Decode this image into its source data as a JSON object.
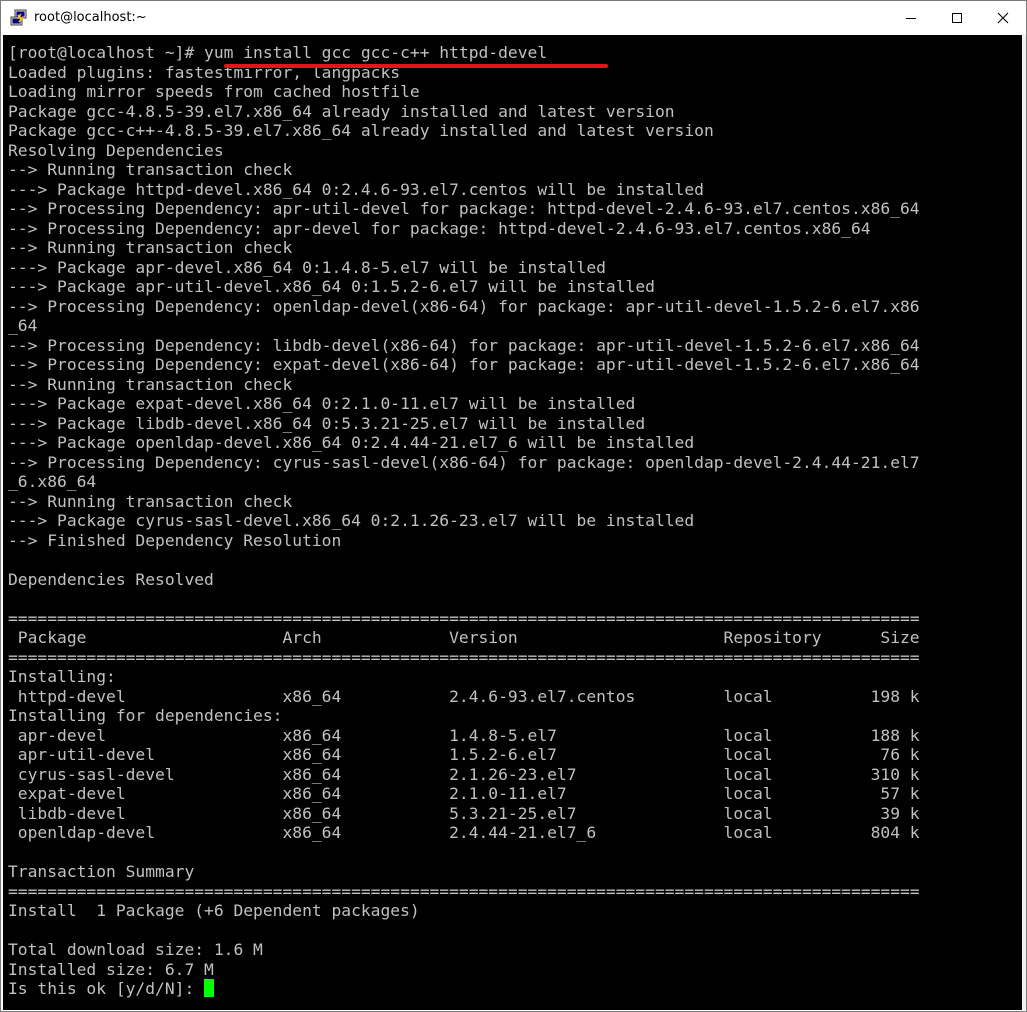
{
  "window": {
    "title": "root@localhost:~",
    "icon": "putty-icon",
    "controls": {
      "minimize": "minimize-icon",
      "maximize": "maximize-icon",
      "close": "close-icon"
    }
  },
  "terminal": {
    "prompt": "[root@localhost ~]# ",
    "command": "yum install gcc gcc-c++ httpd-devel",
    "output": [
      "Loaded plugins: fastestmirror, langpacks",
      "Loading mirror speeds from cached hostfile",
      "Package gcc-4.8.5-39.el7.x86_64 already installed and latest version",
      "Package gcc-c++-4.8.5-39.el7.x86_64 already installed and latest version",
      "Resolving Dependencies",
      "--> Running transaction check",
      "---> Package httpd-devel.x86_64 0:2.4.6-93.el7.centos will be installed",
      "--> Processing Dependency: apr-util-devel for package: httpd-devel-2.4.6-93.el7.centos.x86_64",
      "--> Processing Dependency: apr-devel for package: httpd-devel-2.4.6-93.el7.centos.x86_64",
      "--> Running transaction check",
      "---> Package apr-devel.x86_64 0:1.4.8-5.el7 will be installed",
      "---> Package apr-util-devel.x86_64 0:1.5.2-6.el7 will be installed",
      "--> Processing Dependency: openldap-devel(x86-64) for package: apr-util-devel-1.5.2-6.el7.x86",
      "_64",
      "--> Processing Dependency: libdb-devel(x86-64) for package: apr-util-devel-1.5.2-6.el7.x86_64",
      "--> Processing Dependency: expat-devel(x86-64) for package: apr-util-devel-1.5.2-6.el7.x86_64",
      "--> Running transaction check",
      "---> Package expat-devel.x86_64 0:2.1.0-11.el7 will be installed",
      "---> Package libdb-devel.x86_64 0:5.3.21-25.el7 will be installed",
      "---> Package openldap-devel.x86_64 0:2.4.44-21.el7_6 will be installed",
      "--> Processing Dependency: cyrus-sasl-devel(x86-64) for package: openldap-devel-2.4.44-21.el7",
      "_6.x86_64",
      "--> Running transaction check",
      "---> Package cyrus-sasl-devel.x86_64 0:2.1.26-23.el7 will be installed",
      "--> Finished Dependency Resolution",
      "",
      "Dependencies Resolved",
      "",
      "=============================================================================================",
      " Package                    Arch             Version                     Repository      Size",
      "=============================================================================================",
      "Installing:",
      " httpd-devel                x86_64           2.4.6-93.el7.centos         local          198 k",
      "Installing for dependencies:",
      " apr-devel                  x86_64           1.4.8-5.el7                 local          188 k",
      " apr-util-devel             x86_64           1.5.2-6.el7                 local           76 k",
      " cyrus-sasl-devel           x86_64           2.1.26-23.el7               local          310 k",
      " expat-devel                x86_64           2.1.0-11.el7                local           57 k",
      " libdb-devel                x86_64           5.3.21-25.el7               local           39 k",
      " openldap-devel             x86_64           2.4.44-21.el7_6             local          804 k",
      "",
      "Transaction Summary",
      "=============================================================================================",
      "Install  1 Package (+6 Dependent packages)",
      "",
      "Total download size: 1.6 M",
      "Installed size: 6.7 M"
    ],
    "final_prompt": "Is this ok [y/d/N]: ",
    "colors": {
      "background": "#000000",
      "foreground": "#c0c0c0",
      "cursor": "#00ff00",
      "annotation_underline": "#e4141b"
    }
  }
}
